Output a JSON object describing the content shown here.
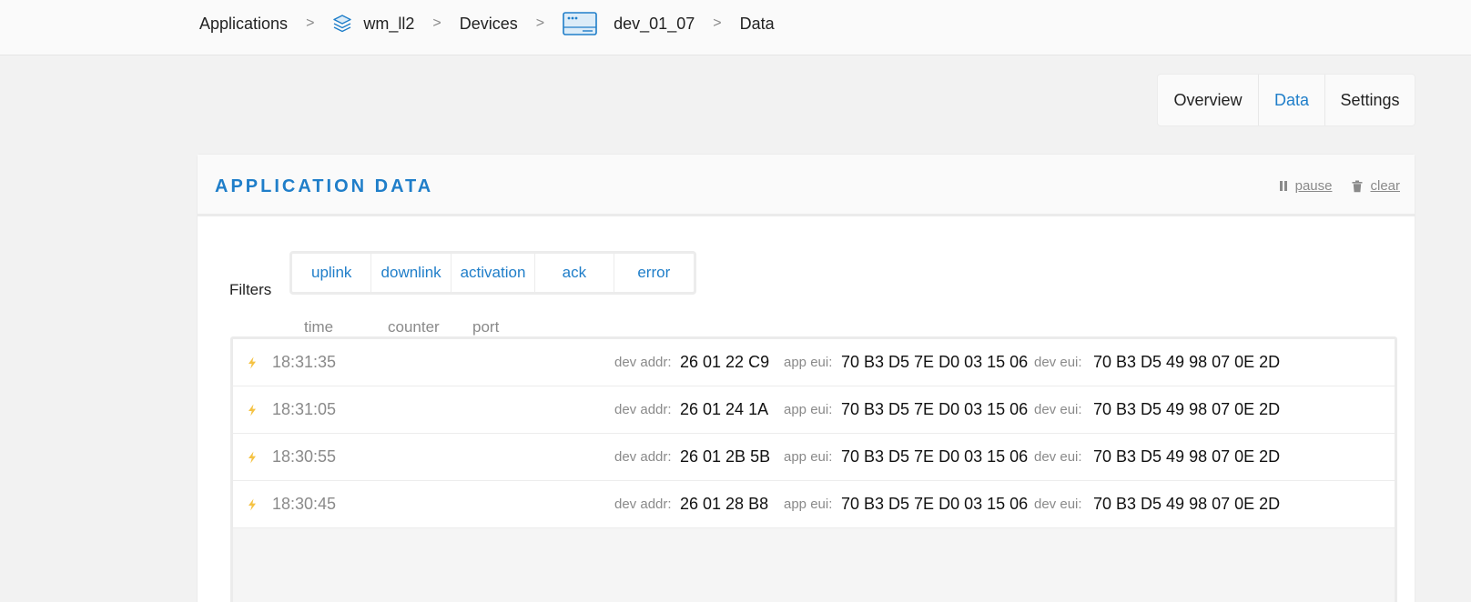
{
  "breadcrumb": {
    "applications": "Applications",
    "app": "wm_ll2",
    "devices": "Devices",
    "device": "dev_01_07",
    "data": "Data",
    "separator": ">"
  },
  "tabs": [
    "Overview",
    "Data",
    "Settings"
  ],
  "active_tab": "Data",
  "panel": {
    "title": "APPLICATION DATA",
    "pause_label": "pause",
    "clear_label": "clear"
  },
  "filters": {
    "label": "Filters",
    "items": [
      "uplink",
      "downlink",
      "activation",
      "ack",
      "error"
    ]
  },
  "columns": {
    "time": "time",
    "counter": "counter",
    "port": "port"
  },
  "row_labels": {
    "dev_addr": "dev addr:",
    "app_eui": "app eui:",
    "dev_eui": "dev eui:"
  },
  "rows": [
    {
      "time": "18:31:35",
      "dev_addr": "26 01 22 C9",
      "app_eui": "70 B3 D5 7E D0 03 15 06",
      "dev_eui": "70 B3 D5 49 98 07 0E 2D"
    },
    {
      "time": "18:31:05",
      "dev_addr": "26 01 24 1A",
      "app_eui": "70 B3 D5 7E D0 03 15 06",
      "dev_eui": "70 B3 D5 49 98 07 0E 2D"
    },
    {
      "time": "18:30:55",
      "dev_addr": "26 01 2B 5B",
      "app_eui": "70 B3 D5 7E D0 03 15 06",
      "dev_eui": "70 B3 D5 49 98 07 0E 2D"
    },
    {
      "time": "18:30:45",
      "dev_addr": "26 01 28 B8",
      "app_eui": "70 B3 D5 7E D0 03 15 06",
      "dev_eui": "70 B3 D5 49 98 07 0E 2D"
    }
  ],
  "colors": {
    "accent": "#1f7ec9",
    "activation_bolt": "#f5c242",
    "muted_text": "#8a8a8a"
  },
  "icons": {
    "app": "layers-icon",
    "device": "device-icon",
    "pause": "pause-icon",
    "clear": "trash-icon",
    "row": "lightning-bolt-icon"
  }
}
